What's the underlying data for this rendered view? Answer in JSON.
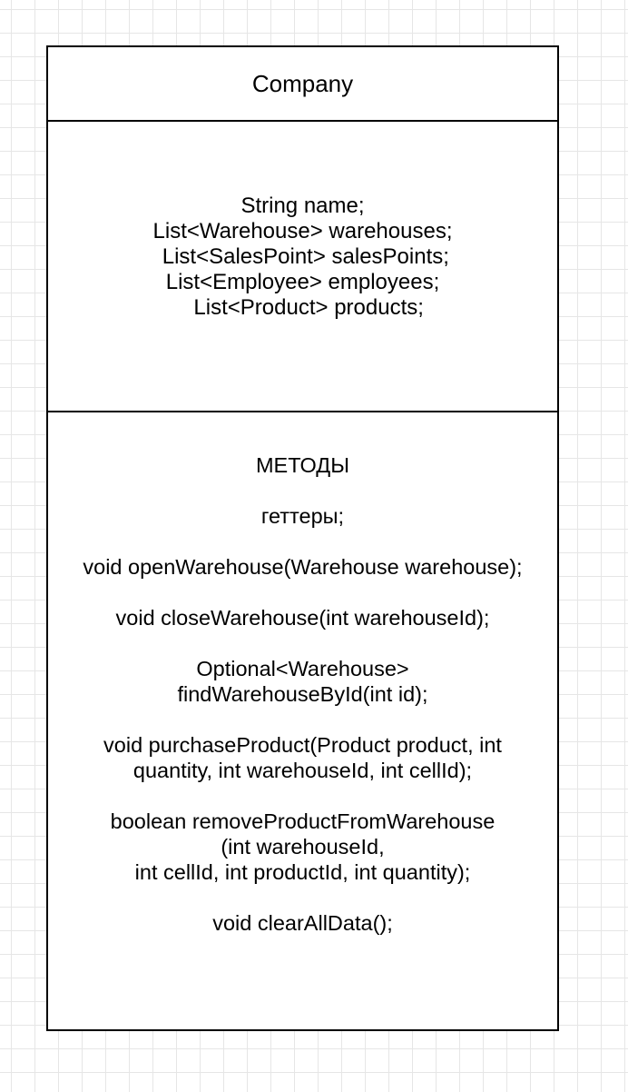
{
  "diagram": {
    "class_name": "Company",
    "fields": [
      "String name;",
      "List<Warehouse> warehouses;",
      " List<SalesPoint> salesPoints;",
      "List<Employee> employees;",
      "  List<Product> products;"
    ],
    "methods": [
      [
        "МЕТОДЫ"
      ],
      [
        "геттеры;"
      ],
      [
        "void openWarehouse(Warehouse warehouse);"
      ],
      [
        "void closeWarehouse(int warehouseId);"
      ],
      [
        "Optional<Warehouse>",
        "findWarehouseById(int id);"
      ],
      [
        "void purchaseProduct(Product product, int",
        "quantity, int warehouseId, int cellId);"
      ],
      [
        "boolean removeProductFromWarehouse",
        "(int warehouseId,",
        "int cellId, int productId, int quantity);"
      ],
      [
        "void clearAllData();"
      ]
    ]
  }
}
